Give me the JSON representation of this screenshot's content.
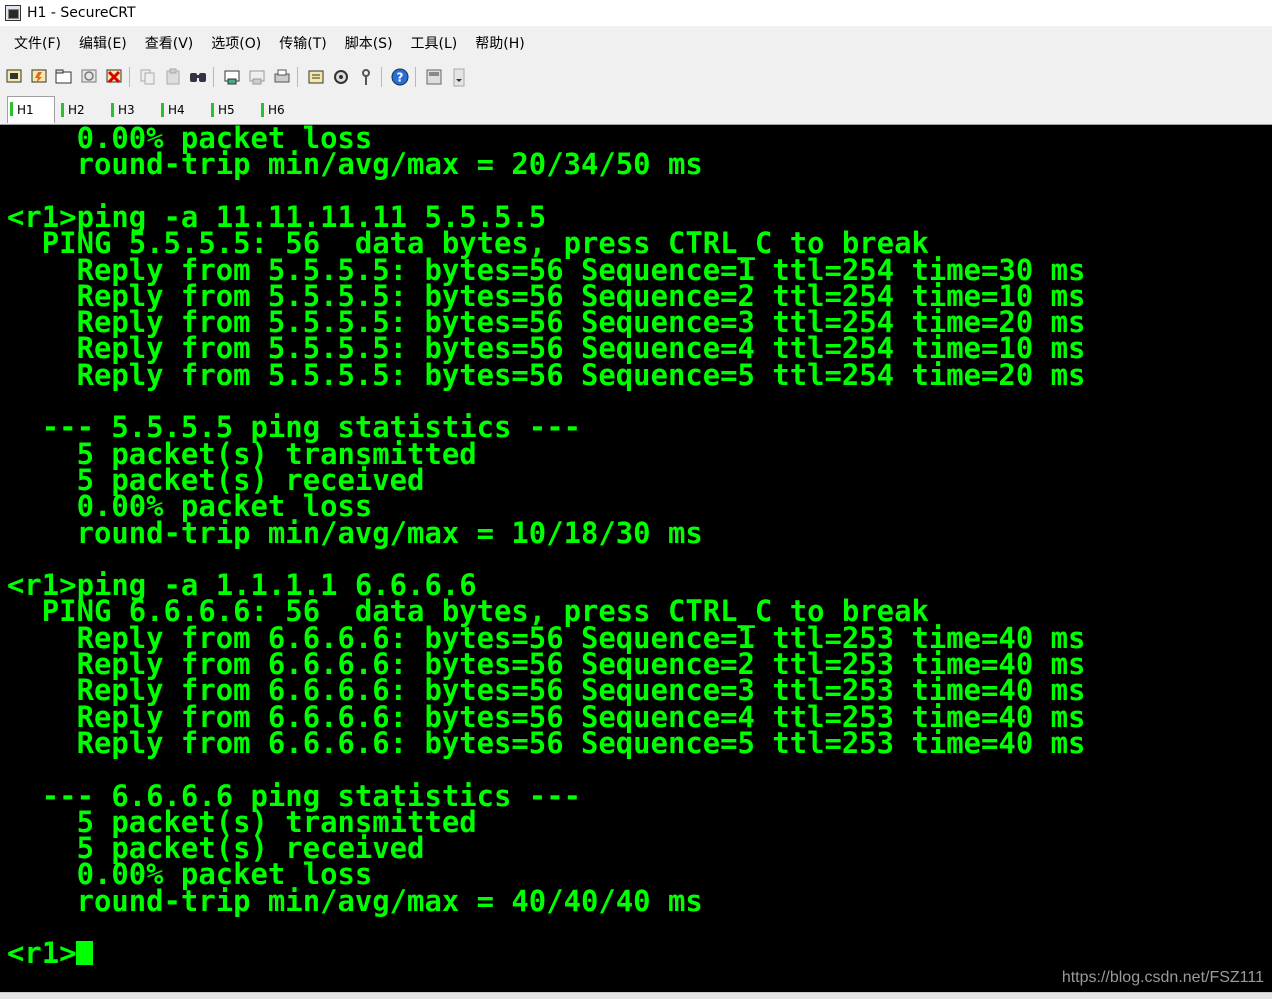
{
  "window": {
    "title": "H1 - SecureCRT"
  },
  "menu": [
    "文件(F)",
    "编辑(E)",
    "查看(V)",
    "选项(O)",
    "传输(T)",
    "脚本(S)",
    "工具(L)",
    "帮助(H)"
  ],
  "toolbar_icons": [
    "connect-icon",
    "quick-connect-icon",
    "connect-in-tab-icon",
    "reconnect-icon",
    "disconnect-icon",
    "copy-icon",
    "paste-icon",
    "find-icon",
    "print-setup-icon",
    "print-selection-icon",
    "print-icon",
    "session-options-icon",
    "global-options-icon",
    "keymap-icon",
    "help-icon",
    "sftp-icon"
  ],
  "tabs": [
    {
      "label": "H1",
      "active": true
    },
    {
      "label": "H2",
      "active": false
    },
    {
      "label": "H3",
      "active": false
    },
    {
      "label": "H4",
      "active": false
    },
    {
      "label": "H5",
      "active": false
    },
    {
      "label": "H6",
      "active": false
    }
  ],
  "terminal": {
    "color": "#00ff00",
    "background": "#000000",
    "lines": [
      "    0.00% packet loss",
      "    round-trip min/avg/max = 20/34/50 ms",
      "",
      "<r1>ping -a 11.11.11.11 5.5.5.5",
      "  PING 5.5.5.5: 56  data bytes, press CTRL_C to break",
      "    Reply from 5.5.5.5: bytes=56 Sequence=1 ttl=254 time=30 ms",
      "    Reply from 5.5.5.5: bytes=56 Sequence=2 ttl=254 time=10 ms",
      "    Reply from 5.5.5.5: bytes=56 Sequence=3 ttl=254 time=20 ms",
      "    Reply from 5.5.5.5: bytes=56 Sequence=4 ttl=254 time=10 ms",
      "    Reply from 5.5.5.5: bytes=56 Sequence=5 ttl=254 time=20 ms",
      "",
      "  --- 5.5.5.5 ping statistics ---",
      "    5 packet(s) transmitted",
      "    5 packet(s) received",
      "    0.00% packet loss",
      "    round-trip min/avg/max = 10/18/30 ms",
      "",
      "<r1>ping -a 1.1.1.1 6.6.6.6",
      "  PING 6.6.6.6: 56  data bytes, press CTRL_C to break",
      "    Reply from 6.6.6.6: bytes=56 Sequence=1 ttl=253 time=40 ms",
      "    Reply from 6.6.6.6: bytes=56 Sequence=2 ttl=253 time=40 ms",
      "    Reply from 6.6.6.6: bytes=56 Sequence=3 ttl=253 time=40 ms",
      "    Reply from 6.6.6.6: bytes=56 Sequence=4 ttl=253 time=40 ms",
      "    Reply from 6.6.6.6: bytes=56 Sequence=5 ttl=253 time=40 ms",
      "",
      "  --- 6.6.6.6 ping statistics ---",
      "    5 packet(s) transmitted",
      "    5 packet(s) received",
      "    0.00% packet loss",
      "    round-trip min/avg/max = 40/40/40 ms",
      "",
      "<r1>"
    ]
  },
  "watermark": "https://blog.csdn.net/FSZ111"
}
